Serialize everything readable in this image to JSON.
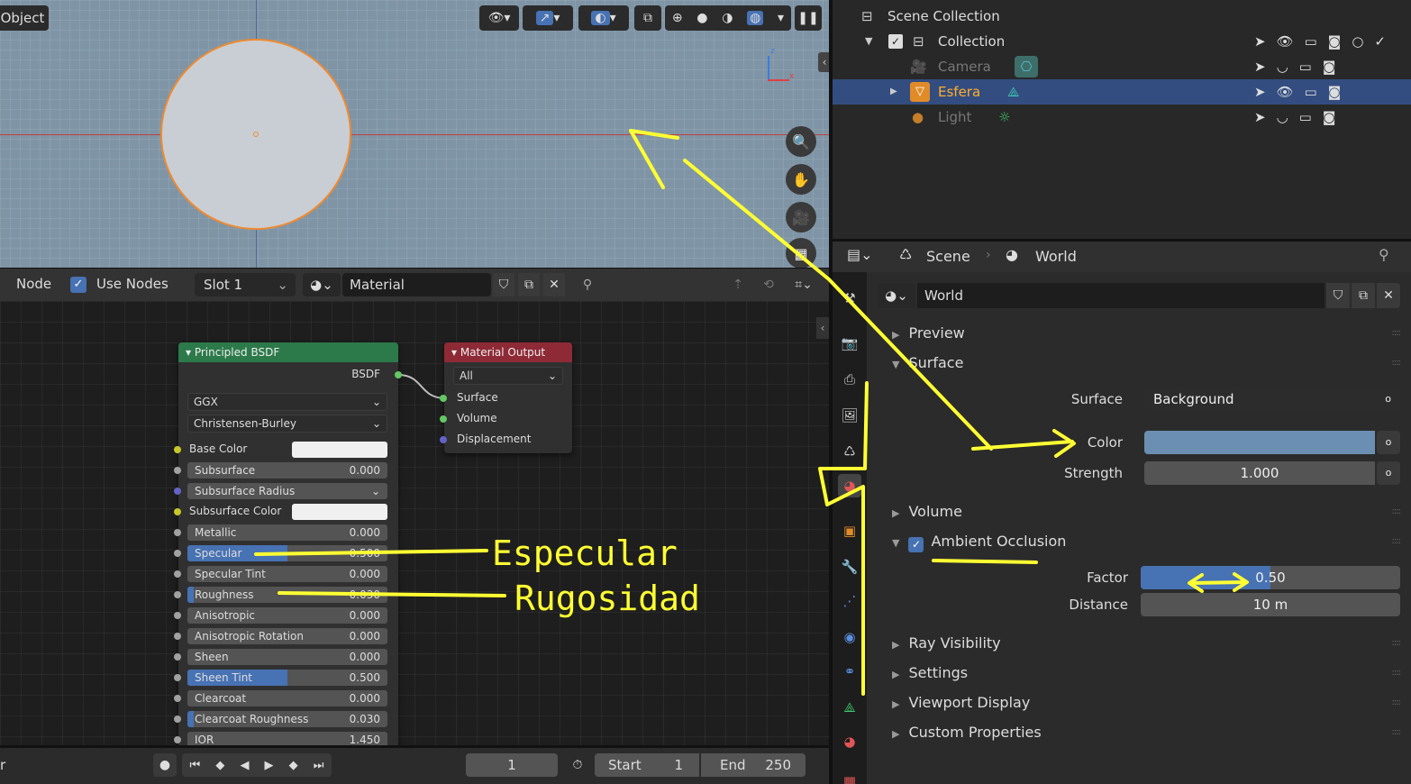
{
  "viewport": {
    "mode_label": "Object"
  },
  "node_header": {
    "menu": "Node",
    "use_nodes_label": "Use Nodes",
    "slot": "Slot 1",
    "material_name": "Material"
  },
  "bsdf": {
    "title": "Principled BSDF",
    "output": "BSDF",
    "distribution": "GGX",
    "subsurface_method": "Christensen-Burley",
    "rows": [
      {
        "label": "Base Color",
        "type": "color",
        "socket": "yellow"
      },
      {
        "label": "Subsurface",
        "value": "0.000",
        "fill": 0,
        "socket": "gray"
      },
      {
        "label": "Subsurface Radius",
        "type": "vector",
        "socket": "blue"
      },
      {
        "label": "Subsurface Color",
        "type": "color",
        "socket": "yellow"
      },
      {
        "label": "Metallic",
        "value": "0.000",
        "fill": 0,
        "socket": "gray"
      },
      {
        "label": "Specular",
        "value": "0.500",
        "fill": 0.5,
        "socket": "gray"
      },
      {
        "label": "Specular Tint",
        "value": "0.000",
        "fill": 0,
        "socket": "gray"
      },
      {
        "label": "Roughness",
        "value": "0.030",
        "fill": 0.03,
        "socket": "gray"
      },
      {
        "label": "Anisotropic",
        "value": "0.000",
        "fill": 0,
        "socket": "gray"
      },
      {
        "label": "Anisotropic Rotation",
        "value": "0.000",
        "fill": 0,
        "socket": "gray"
      },
      {
        "label": "Sheen",
        "value": "0.000",
        "fill": 0,
        "socket": "gray"
      },
      {
        "label": "Sheen Tint",
        "value": "0.500",
        "fill": 0.5,
        "socket": "gray"
      },
      {
        "label": "Clearcoat",
        "value": "0.000",
        "fill": 0,
        "socket": "gray"
      },
      {
        "label": "Clearcoat Roughness",
        "value": "0.030",
        "fill": 0.03,
        "socket": "gray"
      },
      {
        "label": "IOR",
        "value": "1.450",
        "fill": 0,
        "socket": "gray"
      }
    ]
  },
  "matout": {
    "title": "Material Output",
    "target": "All",
    "inputs": [
      "Surface",
      "Volume",
      "Displacement"
    ]
  },
  "annotations": {
    "specular": "Especular",
    "roughness": "Rugosidad"
  },
  "timeline": {
    "left_label": "r",
    "frame": "1",
    "start_label": "Start",
    "start": "1",
    "end_label": "End",
    "end": "250"
  },
  "outliner": {
    "scene_collection": "Scene Collection",
    "collection": "Collection",
    "items": [
      {
        "name": "Camera",
        "selected": false
      },
      {
        "name": "Esfera",
        "selected": true
      },
      {
        "name": "Light",
        "selected": false
      }
    ]
  },
  "props": {
    "scene": "Scene",
    "world": "World",
    "world_name": "World",
    "panels": {
      "preview": "Preview",
      "surface": "Surface",
      "volume": "Volume",
      "ao": "Ambient Occlusion",
      "ray": "Ray Visibility",
      "settings": "Settings",
      "viewport_display": "Viewport Display",
      "custom": "Custom Properties"
    },
    "surface_label": "Surface",
    "surface_value": "Background",
    "color_label": "Color",
    "color_value": "#6b8fb2",
    "strength_label": "Strength",
    "strength_value": "1.000",
    "factor_label": "Factor",
    "factor_value": "0.50",
    "factor_fill": 0.5,
    "distance_label": "Distance",
    "distance_value": "10 m"
  },
  "colors": {
    "accent": "#4772b3",
    "annotation": "#ffff33",
    "selection": "#334d80"
  }
}
